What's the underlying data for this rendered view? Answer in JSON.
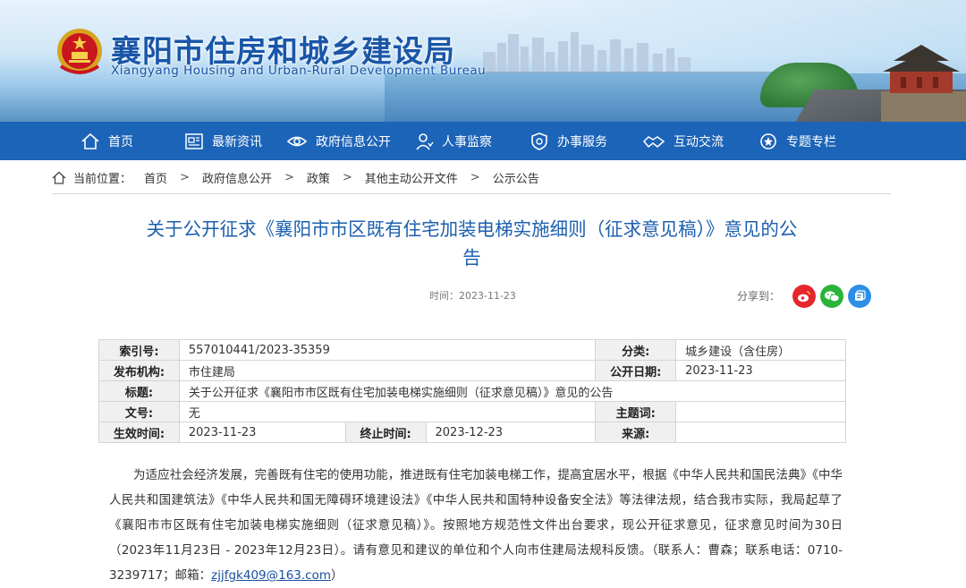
{
  "header": {
    "title_cn": "襄阳市住房和城乡建设局",
    "title_en": "Xiangyang Housing and Urban-Rural Development Bureau"
  },
  "nav": [
    {
      "label": "首页",
      "icon": "home-icon"
    },
    {
      "label": "最新资讯",
      "icon": "news-icon"
    },
    {
      "label": "政府信息公开",
      "icon": "eye-icon"
    },
    {
      "label": "人事监察",
      "icon": "person-icon"
    },
    {
      "label": "办事服务",
      "icon": "shield-icon"
    },
    {
      "label": "互动交流",
      "icon": "hands-icon"
    },
    {
      "label": "专题专栏",
      "icon": "medal-icon"
    }
  ],
  "breadcrumb": {
    "prefix": "当前位置：",
    "items": [
      "首页",
      "政府信息公开",
      "政策",
      "其他主动公开文件",
      "公示公告"
    ],
    "separator": ">"
  },
  "article": {
    "title_line1": "关于公开征求《襄阳市市区既有住宅加装电梯实施细则（征求意见稿）》意见的公",
    "title_line2": "告",
    "time": "时间：2023-11-23",
    "share_label": "分享到："
  },
  "share": [
    {
      "name": "weibo-icon",
      "color": "#e6262d"
    },
    {
      "name": "wechat-icon",
      "color": "#2bb33a"
    },
    {
      "name": "qzone-icon",
      "color": "#2e8ee6"
    }
  ],
  "info": {
    "index_key": "索引号:",
    "index_val": "557010441/2023-35359",
    "category_key": "分类:",
    "category_val": "城乡建设（含住房）",
    "org_key": "发布机构:",
    "org_val": "市住建局",
    "pubdate_key": "公开日期:",
    "pubdate_val": "2023-11-23",
    "title_key": "标题:",
    "title_val": "关于公开征求《襄阳市市区既有住宅加装电梯实施细则（征求意见稿）》意见的公告",
    "docno_key": "文号:",
    "docno_val": "无",
    "topic_key": "主题词:",
    "topic_val": "",
    "effective_key": "生效时间:",
    "effective_val": "2023-11-23",
    "end_key": "终止时间:",
    "end_val": "2023-12-23",
    "source_key": "来源:",
    "source_val": ""
  },
  "body": {
    "paragraph": "为适应社会经济发展，完善既有住宅的使用功能，推进既有住宅加装电梯工作，提高宜居水平，根据《中华人民共和国民法典》《中华人民共和国建筑法》《中华人民共和国无障碍环境建设法》《中华人民共和国特种设备安全法》等法律法规，结合我市实际，我局起草了《襄阳市市区既有住宅加装电梯实施细则（征求意见稿）》。按照地方规范性文件出台要求，现公开征求意见，征求意见时间为30日（2023年11月23日 - 2023年12月23日）。请有意见和建议的单位和个人向市住建局法规科反馈。（联系人：曹森；联系电话：0710-3239717；邮箱：",
    "email": "zjjfgk409@163.com",
    "closing": "）"
  },
  "colors": {
    "nav_bg": "#1c64b8",
    "title_blue": "#1c5fae",
    "brand_blue": "#1a56a8"
  }
}
